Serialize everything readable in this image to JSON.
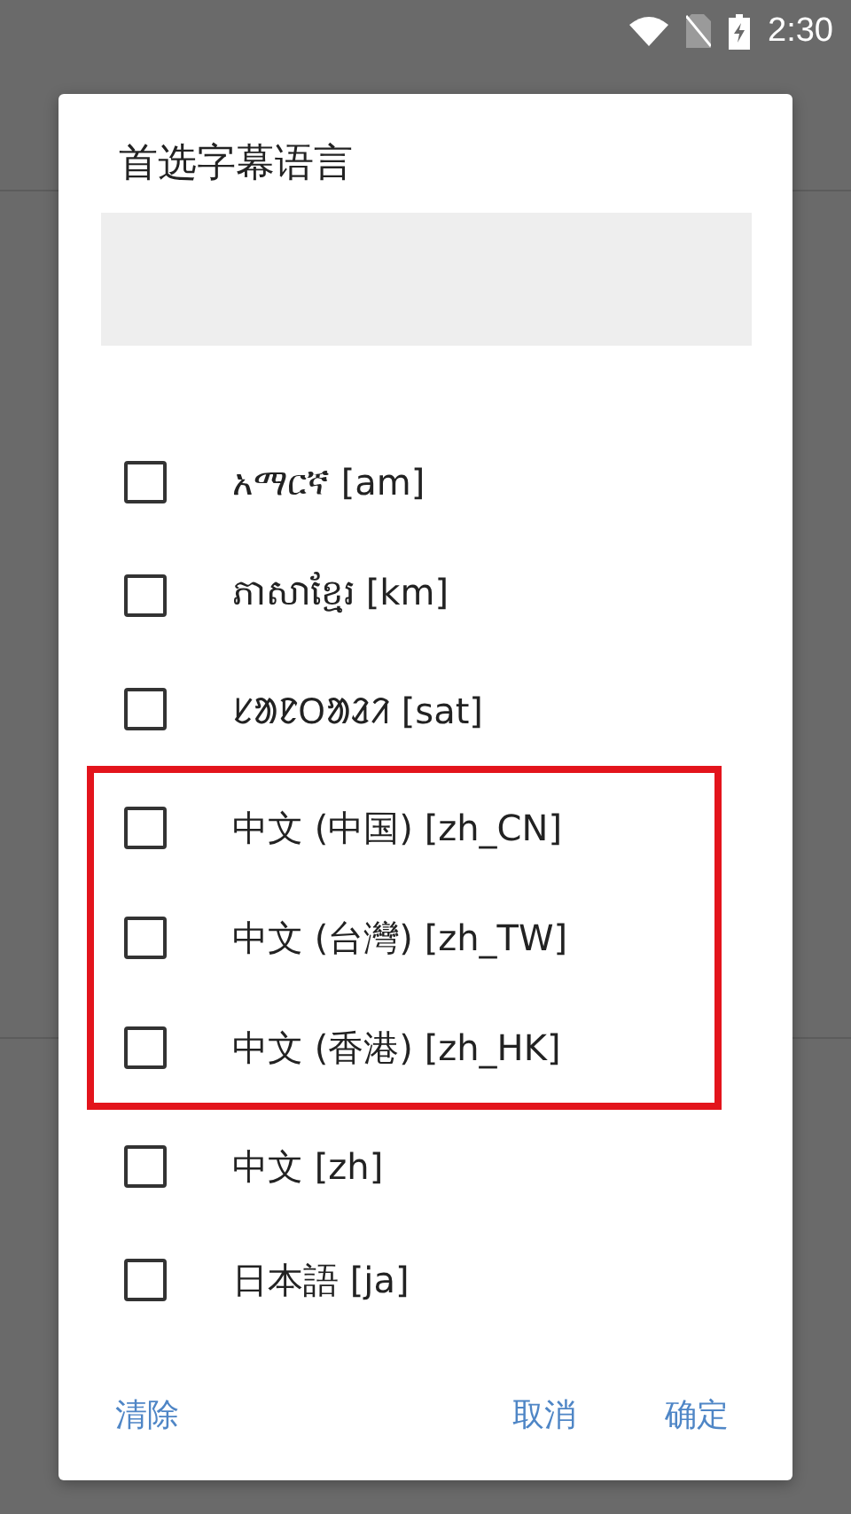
{
  "status_bar": {
    "time": "2:30"
  },
  "dialog": {
    "title": "首选字幕语言",
    "items": [
      {
        "label": "አማርኛ [am]",
        "checked": false,
        "highlighted": false
      },
      {
        "label": "ភាសាខ្មែរ [km]",
        "checked": false,
        "highlighted": false
      },
      {
        "label": "ᱥᱟᱱᱛᱟᱲᱤ [sat]",
        "checked": false,
        "highlighted": false
      },
      {
        "label": "中文 (中国) [zh_CN]",
        "checked": false,
        "highlighted": true
      },
      {
        "label": "中文 (台灣) [zh_TW]",
        "checked": false,
        "highlighted": true
      },
      {
        "label": "中文 (香港) [zh_HK]",
        "checked": false,
        "highlighted": true
      },
      {
        "label": "中文 [zh]",
        "checked": false,
        "highlighted": false
      },
      {
        "label": "日本語 [ja]",
        "checked": false,
        "highlighted": false
      }
    ],
    "buttons": [
      {
        "label": "清除",
        "kind": "neutral"
      },
      {
        "label": "取消",
        "kind": "negative"
      },
      {
        "label": "确定",
        "kind": "positive"
      }
    ]
  }
}
